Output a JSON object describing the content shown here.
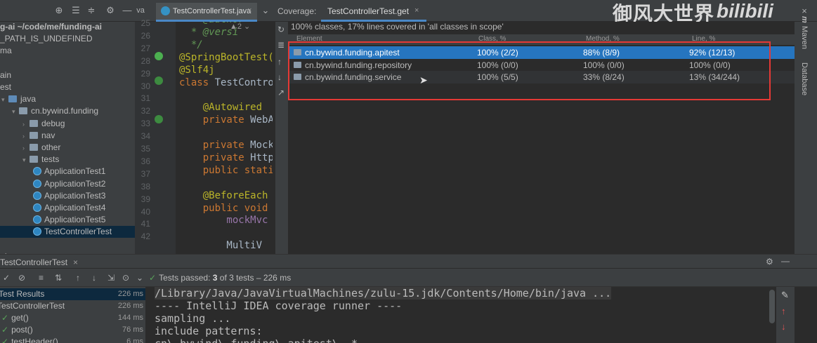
{
  "toolbar": {
    "left_label": "va",
    "editor_tab": "TestControllerTest.java",
    "coverage_label": "Coverage:",
    "coverage_tab": "TestControllerTest.get",
    "close": "×",
    "hint": "▲2 ⌄"
  },
  "watermark": {
    "text": "御风大世界",
    "logo": "bilibili"
  },
  "project_tree": [
    {
      "text": "g-ai  ~/code/me/funding-ai",
      "indent": 0,
      "kind": "text"
    },
    {
      "text": "_PATH_IS_UNDEFINED",
      "indent": 0,
      "kind": "text"
    },
    {
      "text": "ma",
      "indent": 0,
      "kind": "text"
    },
    {
      "text": "",
      "indent": 0,
      "kind": "text"
    },
    {
      "text": "ain",
      "indent": 0,
      "kind": "text"
    },
    {
      "text": "est",
      "indent": 0,
      "kind": "text"
    },
    {
      "text": "java",
      "indent": 0,
      "kind": "folder-blue",
      "arrow": "▾"
    },
    {
      "text": "cn.bywind.funding",
      "indent": 1,
      "kind": "folder",
      "arrow": "▾"
    },
    {
      "text": "debug",
      "indent": 2,
      "kind": "folder",
      "arrow": "›"
    },
    {
      "text": "nav",
      "indent": 2,
      "kind": "folder",
      "arrow": "›"
    },
    {
      "text": "other",
      "indent": 2,
      "kind": "folder",
      "arrow": "›"
    },
    {
      "text": "tests",
      "indent": 2,
      "kind": "folder",
      "arrow": "▾"
    },
    {
      "text": "ApplicationTest1",
      "indent": 3,
      "kind": "class"
    },
    {
      "text": "ApplicationTest2",
      "indent": 3,
      "kind": "class"
    },
    {
      "text": "ApplicationTest3",
      "indent": 3,
      "kind": "class"
    },
    {
      "text": "ApplicationTest4",
      "indent": 3,
      "kind": "class"
    },
    {
      "text": "ApplicationTest5",
      "indent": 3,
      "kind": "class"
    },
    {
      "text": "TestControllerTest",
      "indent": 3,
      "kind": "class",
      "selected": true
    },
    {
      "text": "",
      "indent": 0,
      "kind": "text"
    },
    {
      "text": "et",
      "indent": 0,
      "kind": "text"
    }
  ],
  "gutter": {
    "lines": [
      "25",
      "26",
      "27",
      "28",
      "29",
      "30",
      "31",
      "32",
      "33",
      "34",
      "35",
      "36",
      "37",
      "38",
      "39",
      "40",
      "41",
      "42"
    ]
  },
  "code_lines": [
    {
      "parts": [
        [
          "cmt",
          "  * @author"
        ]
      ]
    },
    {
      "parts": [
        [
          "cmt",
          "  * @versi"
        ]
      ]
    },
    {
      "parts": [
        [
          "cmt",
          "  */"
        ]
      ]
    },
    {
      "parts": [
        [
          "ann",
          "@SpringBootTest("
        ]
      ]
    },
    {
      "parts": [
        [
          "ann",
          "@Slf4j"
        ]
      ]
    },
    {
      "parts": [
        [
          "kw",
          "class "
        ],
        [
          "id",
          "TestContro"
        ]
      ]
    },
    {
      "parts": [
        [
          "id",
          ""
        ]
      ]
    },
    {
      "parts": [
        [
          "ann",
          "    @Autowired"
        ]
      ]
    },
    {
      "parts": [
        [
          "kw",
          "    private "
        ],
        [
          "id",
          "WebA"
        ]
      ]
    },
    {
      "parts": [
        [
          "id",
          ""
        ]
      ]
    },
    {
      "parts": [
        [
          "kw",
          "    private "
        ],
        [
          "id",
          "Mock"
        ]
      ]
    },
    {
      "parts": [
        [
          "kw",
          "    private "
        ],
        [
          "id",
          "Http"
        ]
      ]
    },
    {
      "parts": [
        [
          "kw",
          "    public static"
        ]
      ]
    },
    {
      "parts": [
        [
          "id",
          ""
        ]
      ]
    },
    {
      "parts": [
        [
          "ann",
          "    @BeforeEach"
        ]
      ]
    },
    {
      "parts": [
        [
          "kw",
          "    public void"
        ]
      ]
    },
    {
      "parts": [
        [
          "fld",
          "        mockMvc"
        ]
      ]
    },
    {
      "parts": [
        [
          "id",
          ""
        ]
      ]
    },
    {
      "parts": [
        [
          "id",
          "        MultiV"
        ]
      ]
    }
  ],
  "coverage": {
    "summary": "100% classes, 17% lines covered in 'all classes in scope'",
    "headers": {
      "element": "Element",
      "class": "Class, %",
      "method": "Method, %",
      "line": "Line, %"
    },
    "rows": [
      {
        "element": "cn.bywind.funding.apitest",
        "class": "100% (2/2)",
        "method": "88% (8/9)",
        "line": "92% (12/13)"
      },
      {
        "element": "cn.bywind.funding.repository",
        "class": "100% (0/0)",
        "method": "100% (0/0)",
        "line": "100% (0/0)"
      },
      {
        "element": "cn.bywind.funding.service",
        "class": "100% (5/5)",
        "method": "33% (8/24)",
        "line": "13% (34/244)"
      }
    ]
  },
  "right_strip": {
    "maven": "Maven",
    "database": "Database",
    "m": "m"
  },
  "run": {
    "tab": "TestControllerTest",
    "tab_close": "×",
    "passed_prefix": "Tests passed: ",
    "passed_count": "3",
    "passed_suffix": " of 3 tests – 226 ms",
    "results": [
      {
        "name": "Test Results",
        "time": "226 ms",
        "indent": 0,
        "ok": false,
        "selected": true
      },
      {
        "name": "TestControllerTest",
        "time": "226 ms",
        "indent": 0,
        "ok": true
      },
      {
        "name": "get()",
        "time": "144 ms",
        "indent": 1,
        "ok": true
      },
      {
        "name": "post()",
        "time": "76 ms",
        "indent": 1,
        "ok": true
      },
      {
        "name": "testHeader()",
        "time": "6 ms",
        "indent": 1,
        "ok": true
      }
    ],
    "console": [
      "/Library/Java/JavaVirtualMachines/zulu-15.jdk/Contents/Home/bin/java ...",
      "---- IntelliJ IDEA coverage runner ----",
      "sampling ...",
      "include patterns:",
      "cn\\.bywind\\.funding\\.apitest\\..*"
    ]
  }
}
